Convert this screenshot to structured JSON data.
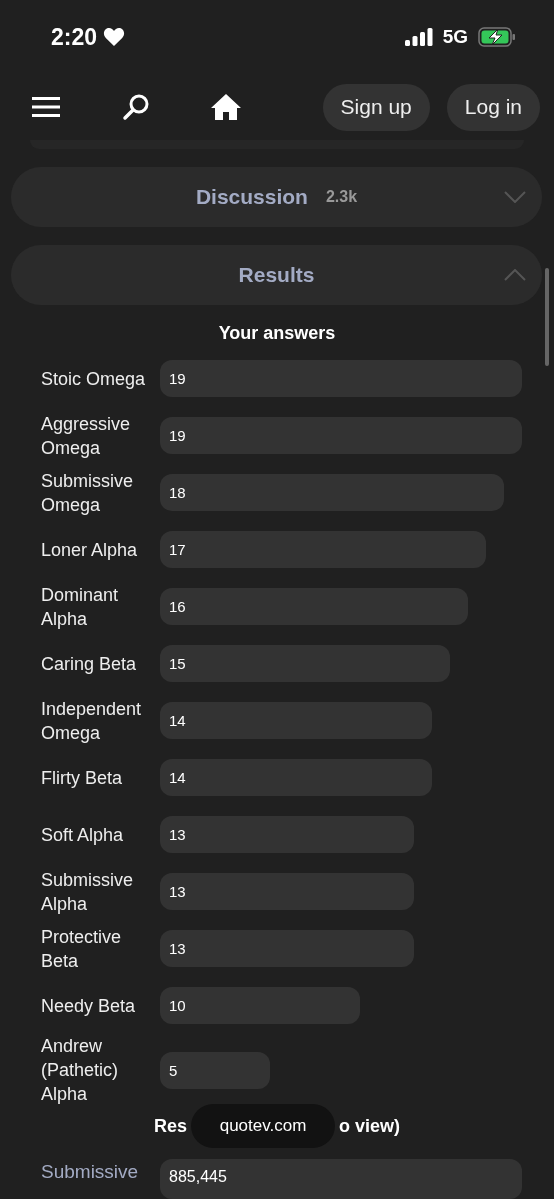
{
  "status_bar": {
    "time": "2:20",
    "network": "5G"
  },
  "nav": {
    "buttons": [
      "Sign up",
      "Log in"
    ]
  },
  "sections": [
    {
      "title": "Discussion",
      "count": "2.3k",
      "expanded": false
    },
    {
      "title": "Results",
      "expanded": true
    }
  ],
  "answers": {
    "title": "Your answers",
    "rows": [
      {
        "label": "Stoic Omega",
        "value": "19"
      },
      {
        "label": "Aggressive Omega",
        "value": "19"
      },
      {
        "label": "Submissive Omega",
        "value": "18"
      },
      {
        "label": "Loner Alpha",
        "value": "17"
      },
      {
        "label": "Dominant Alpha",
        "value": "16"
      },
      {
        "label": "Caring Beta",
        "value": "15"
      },
      {
        "label": "Independent Omega",
        "value": "14"
      },
      {
        "label": "Flirty Beta",
        "value": "14"
      },
      {
        "label": "Soft Alpha",
        "value": "13"
      },
      {
        "label": "Submissive Alpha",
        "value": "13"
      },
      {
        "label": "Protective Beta",
        "value": "13"
      },
      {
        "label": "Needy Beta",
        "value": "10"
      },
      {
        "label": "Andrew (Pathetic) Alpha",
        "value": "5"
      }
    ]
  },
  "totals": {
    "title_parts": [
      "Res",
      "o view)"
    ],
    "rows": [
      {
        "label": "Submissive",
        "value": "885,445"
      }
    ]
  },
  "toast": "quotev.com"
}
